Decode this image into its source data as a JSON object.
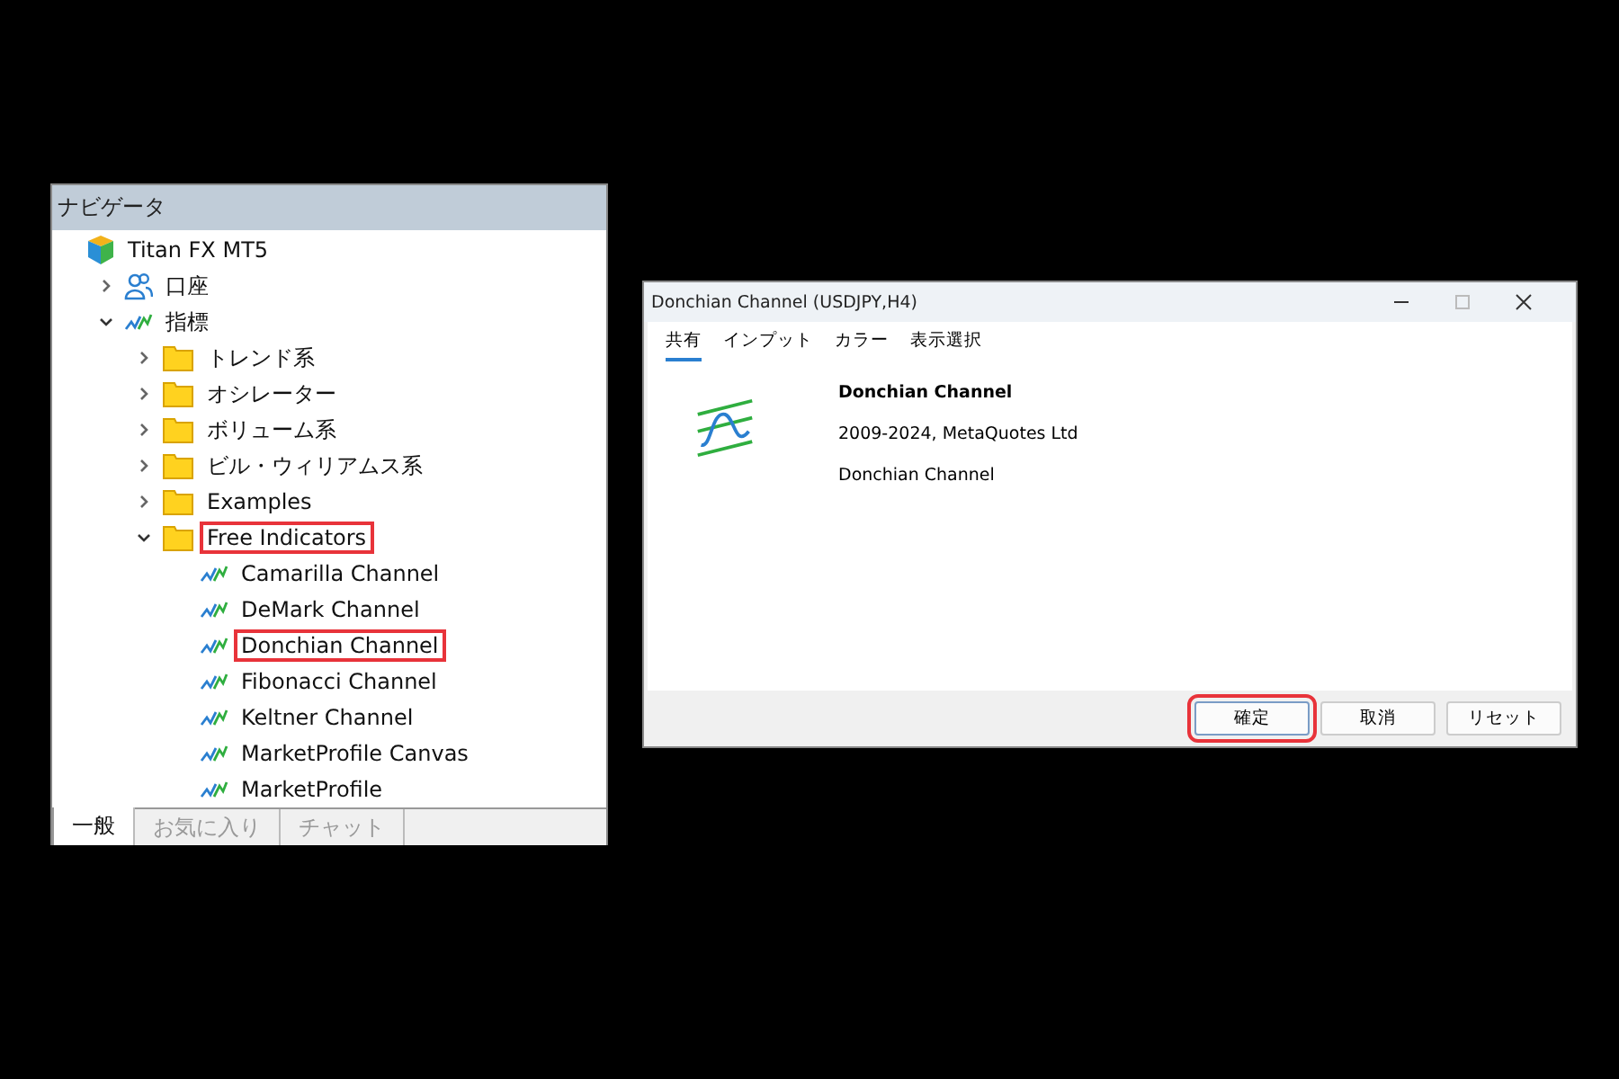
{
  "navigator": {
    "title": "ナビゲータ",
    "tree": [
      {
        "label": "Titan FX MT5",
        "kind": "broker",
        "highlighted": false,
        "children": [
          {
            "label": "口座",
            "kind": "accounts",
            "expanded": false,
            "highlighted": false
          },
          {
            "label": "指標",
            "kind": "indicators",
            "expanded": true,
            "highlighted": false,
            "children": [
              {
                "label": "トレンド系",
                "kind": "folder",
                "expanded": false,
                "highlighted": false
              },
              {
                "label": "オシレーター",
                "kind": "folder",
                "expanded": false,
                "highlighted": false
              },
              {
                "label": "ボリューム系",
                "kind": "folder",
                "expanded": false,
                "highlighted": false
              },
              {
                "label": "ビル・ウィリアムス系",
                "kind": "folder",
                "expanded": false,
                "highlighted": false
              },
              {
                "label": "Examples",
                "kind": "folder",
                "expanded": false,
                "highlighted": false
              },
              {
                "label": "Free Indicators",
                "kind": "folder",
                "expanded": true,
                "highlighted": true,
                "children": [
                  {
                    "label": "Camarilla Channel",
                    "kind": "indicator",
                    "highlighted": false
                  },
                  {
                    "label": "DeMark Channel",
                    "kind": "indicator",
                    "highlighted": false
                  },
                  {
                    "label": "Donchian Channel",
                    "kind": "indicator",
                    "highlighted": true
                  },
                  {
                    "label": "Fibonacci Channel",
                    "kind": "indicator",
                    "highlighted": false
                  },
                  {
                    "label": "Keltner Channel",
                    "kind": "indicator",
                    "highlighted": false
                  },
                  {
                    "label": "MarketProfile Canvas",
                    "kind": "indicator",
                    "highlighted": false
                  },
                  {
                    "label": "MarketProfile",
                    "kind": "indicator",
                    "highlighted": false
                  }
                ]
              }
            ]
          }
        ]
      }
    ],
    "tabs": [
      {
        "label": "一般",
        "selected": true
      },
      {
        "label": "お気に入り",
        "selected": false
      },
      {
        "label": "チャット",
        "selected": false
      }
    ]
  },
  "dialog": {
    "title": "Donchian Channel (USDJPY,H4)",
    "tabs": [
      {
        "label": "共有",
        "selected": true
      },
      {
        "label": "インプット",
        "selected": false
      },
      {
        "label": "カラー",
        "selected": false
      },
      {
        "label": "表示選択",
        "selected": false
      }
    ],
    "name": "Donchian Channel",
    "copyright": "2009-2024, MetaQuotes Ltd",
    "description": "Donchian Channel",
    "buttons": [
      {
        "label": "確定",
        "highlighted": true
      },
      {
        "label": "取消",
        "highlighted": false
      },
      {
        "label": "リセット",
        "highlighted": false
      }
    ]
  }
}
